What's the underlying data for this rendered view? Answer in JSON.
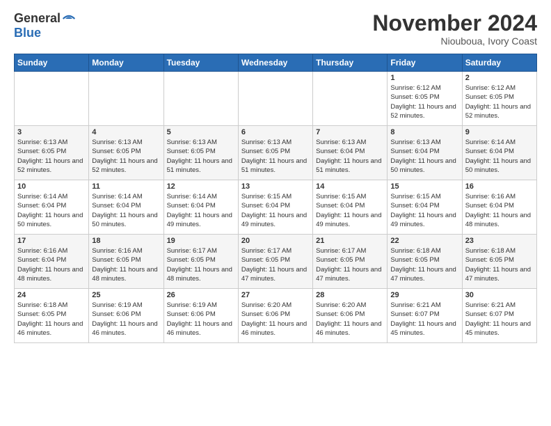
{
  "logo": {
    "general": "General",
    "blue": "Blue"
  },
  "title": "November 2024",
  "location": "Niouboua, Ivory Coast",
  "days_of_week": [
    "Sunday",
    "Monday",
    "Tuesday",
    "Wednesday",
    "Thursday",
    "Friday",
    "Saturday"
  ],
  "weeks": [
    [
      {
        "day": "",
        "info": ""
      },
      {
        "day": "",
        "info": ""
      },
      {
        "day": "",
        "info": ""
      },
      {
        "day": "",
        "info": ""
      },
      {
        "day": "",
        "info": ""
      },
      {
        "day": "1",
        "sunrise": "Sunrise: 6:12 AM",
        "sunset": "Sunset: 6:05 PM",
        "daylight": "Daylight: 11 hours and 52 minutes."
      },
      {
        "day": "2",
        "sunrise": "Sunrise: 6:12 AM",
        "sunset": "Sunset: 6:05 PM",
        "daylight": "Daylight: 11 hours and 52 minutes."
      }
    ],
    [
      {
        "day": "3",
        "sunrise": "Sunrise: 6:13 AM",
        "sunset": "Sunset: 6:05 PM",
        "daylight": "Daylight: 11 hours and 52 minutes."
      },
      {
        "day": "4",
        "sunrise": "Sunrise: 6:13 AM",
        "sunset": "Sunset: 6:05 PM",
        "daylight": "Daylight: 11 hours and 52 minutes."
      },
      {
        "day": "5",
        "sunrise": "Sunrise: 6:13 AM",
        "sunset": "Sunset: 6:05 PM",
        "daylight": "Daylight: 11 hours and 51 minutes."
      },
      {
        "day": "6",
        "sunrise": "Sunrise: 6:13 AM",
        "sunset": "Sunset: 6:05 PM",
        "daylight": "Daylight: 11 hours and 51 minutes."
      },
      {
        "day": "7",
        "sunrise": "Sunrise: 6:13 AM",
        "sunset": "Sunset: 6:04 PM",
        "daylight": "Daylight: 11 hours and 51 minutes."
      },
      {
        "day": "8",
        "sunrise": "Sunrise: 6:13 AM",
        "sunset": "Sunset: 6:04 PM",
        "daylight": "Daylight: 11 hours and 50 minutes."
      },
      {
        "day": "9",
        "sunrise": "Sunrise: 6:14 AM",
        "sunset": "Sunset: 6:04 PM",
        "daylight": "Daylight: 11 hours and 50 minutes."
      }
    ],
    [
      {
        "day": "10",
        "sunrise": "Sunrise: 6:14 AM",
        "sunset": "Sunset: 6:04 PM",
        "daylight": "Daylight: 11 hours and 50 minutes."
      },
      {
        "day": "11",
        "sunrise": "Sunrise: 6:14 AM",
        "sunset": "Sunset: 6:04 PM",
        "daylight": "Daylight: 11 hours and 50 minutes."
      },
      {
        "day": "12",
        "sunrise": "Sunrise: 6:14 AM",
        "sunset": "Sunset: 6:04 PM",
        "daylight": "Daylight: 11 hours and 49 minutes."
      },
      {
        "day": "13",
        "sunrise": "Sunrise: 6:15 AM",
        "sunset": "Sunset: 6:04 PM",
        "daylight": "Daylight: 11 hours and 49 minutes."
      },
      {
        "day": "14",
        "sunrise": "Sunrise: 6:15 AM",
        "sunset": "Sunset: 6:04 PM",
        "daylight": "Daylight: 11 hours and 49 minutes."
      },
      {
        "day": "15",
        "sunrise": "Sunrise: 6:15 AM",
        "sunset": "Sunset: 6:04 PM",
        "daylight": "Daylight: 11 hours and 49 minutes."
      },
      {
        "day": "16",
        "sunrise": "Sunrise: 6:16 AM",
        "sunset": "Sunset: 6:04 PM",
        "daylight": "Daylight: 11 hours and 48 minutes."
      }
    ],
    [
      {
        "day": "17",
        "sunrise": "Sunrise: 6:16 AM",
        "sunset": "Sunset: 6:04 PM",
        "daylight": "Daylight: 11 hours and 48 minutes."
      },
      {
        "day": "18",
        "sunrise": "Sunrise: 6:16 AM",
        "sunset": "Sunset: 6:05 PM",
        "daylight": "Daylight: 11 hours and 48 minutes."
      },
      {
        "day": "19",
        "sunrise": "Sunrise: 6:17 AM",
        "sunset": "Sunset: 6:05 PM",
        "daylight": "Daylight: 11 hours and 48 minutes."
      },
      {
        "day": "20",
        "sunrise": "Sunrise: 6:17 AM",
        "sunset": "Sunset: 6:05 PM",
        "daylight": "Daylight: 11 hours and 47 minutes."
      },
      {
        "day": "21",
        "sunrise": "Sunrise: 6:17 AM",
        "sunset": "Sunset: 6:05 PM",
        "daylight": "Daylight: 11 hours and 47 minutes."
      },
      {
        "day": "22",
        "sunrise": "Sunrise: 6:18 AM",
        "sunset": "Sunset: 6:05 PM",
        "daylight": "Daylight: 11 hours and 47 minutes."
      },
      {
        "day": "23",
        "sunrise": "Sunrise: 6:18 AM",
        "sunset": "Sunset: 6:05 PM",
        "daylight": "Daylight: 11 hours and 47 minutes."
      }
    ],
    [
      {
        "day": "24",
        "sunrise": "Sunrise: 6:18 AM",
        "sunset": "Sunset: 6:05 PM",
        "daylight": "Daylight: 11 hours and 46 minutes."
      },
      {
        "day": "25",
        "sunrise": "Sunrise: 6:19 AM",
        "sunset": "Sunset: 6:06 PM",
        "daylight": "Daylight: 11 hours and 46 minutes."
      },
      {
        "day": "26",
        "sunrise": "Sunrise: 6:19 AM",
        "sunset": "Sunset: 6:06 PM",
        "daylight": "Daylight: 11 hours and 46 minutes."
      },
      {
        "day": "27",
        "sunrise": "Sunrise: 6:20 AM",
        "sunset": "Sunset: 6:06 PM",
        "daylight": "Daylight: 11 hours and 46 minutes."
      },
      {
        "day": "28",
        "sunrise": "Sunrise: 6:20 AM",
        "sunset": "Sunset: 6:06 PM",
        "daylight": "Daylight: 11 hours and 46 minutes."
      },
      {
        "day": "29",
        "sunrise": "Sunrise: 6:21 AM",
        "sunset": "Sunset: 6:07 PM",
        "daylight": "Daylight: 11 hours and 45 minutes."
      },
      {
        "day": "30",
        "sunrise": "Sunrise: 6:21 AM",
        "sunset": "Sunset: 6:07 PM",
        "daylight": "Daylight: 11 hours and 45 minutes."
      }
    ]
  ]
}
